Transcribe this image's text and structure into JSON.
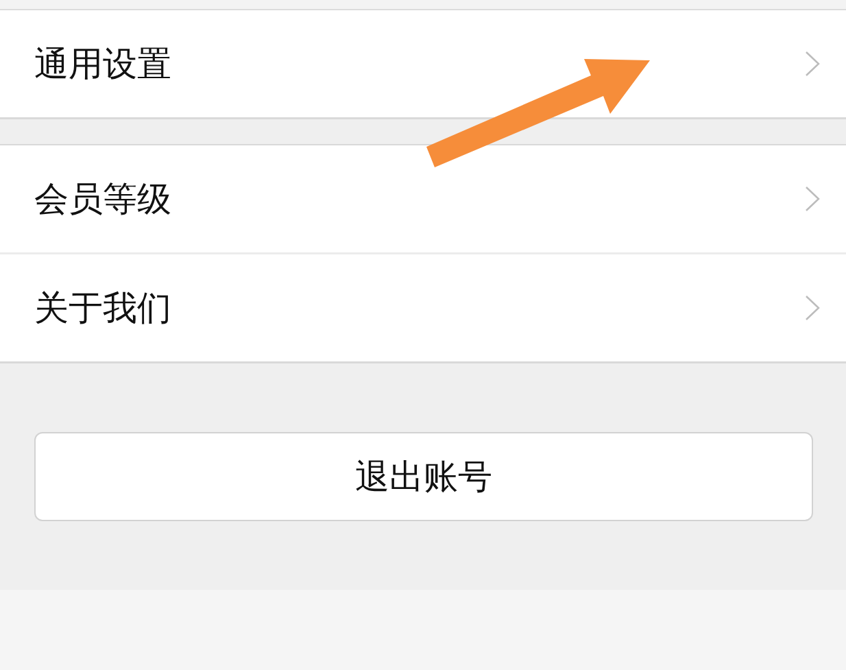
{
  "groups": [
    {
      "items": [
        {
          "label": "通用设置"
        }
      ]
    },
    {
      "items": [
        {
          "label": "会员等级"
        },
        {
          "label": "关于我们"
        }
      ]
    }
  ],
  "logout_button": {
    "label": "退出账号"
  }
}
